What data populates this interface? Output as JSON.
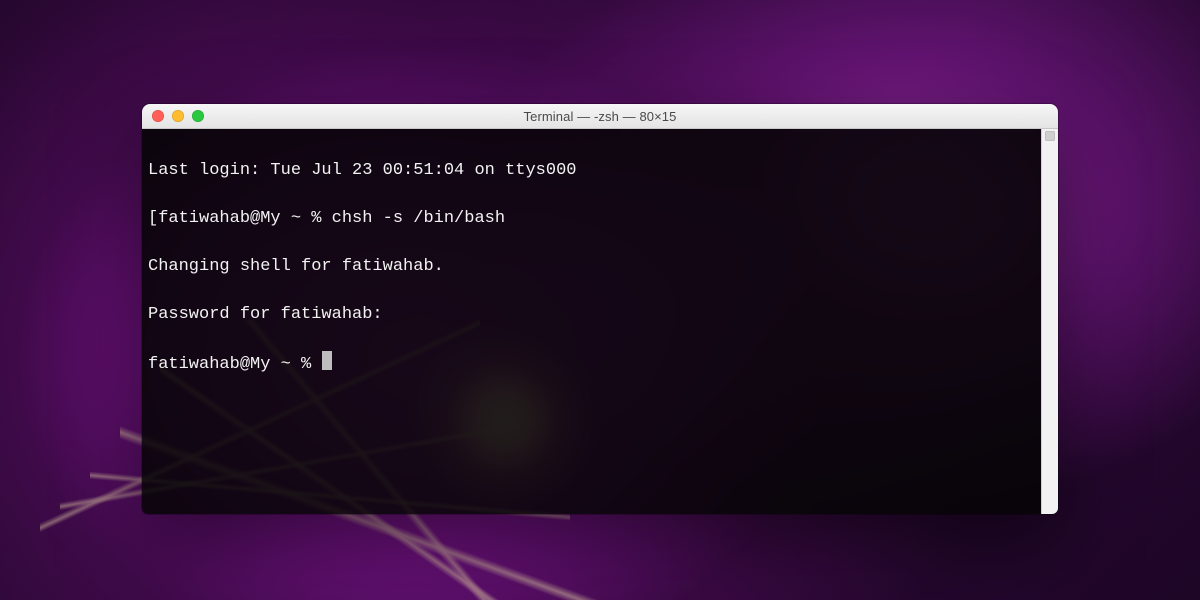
{
  "window": {
    "title": "Terminal — -zsh — 80×15"
  },
  "terminal": {
    "lines": {
      "0": "Last login: Tue Jul 23 00:51:04 on ttys000",
      "1": "[fatiwahab@My ~ % chsh -s /bin/bash",
      "2": "Changing shell for fatiwahab.",
      "3": "Password for fatiwahab:",
      "4_prompt": "fatiwahab@My ~ % "
    }
  }
}
